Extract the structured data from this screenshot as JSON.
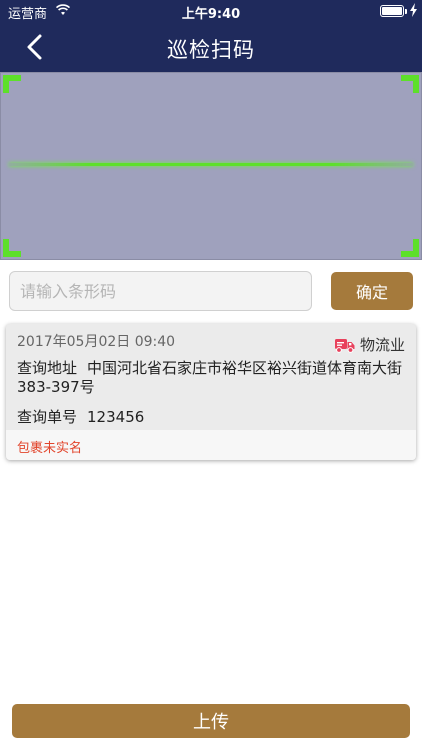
{
  "status_bar": {
    "carrier": "运营商",
    "time": "上午9:40",
    "icons": [
      "wifi-icon",
      "battery-icon",
      "charging-bolt-icon"
    ]
  },
  "nav": {
    "title": "巡检扫码",
    "back_icon": "chevron-left-icon"
  },
  "scanner": {
    "frame_color": "#5de02a"
  },
  "barcode": {
    "placeholder": "请输入条形码",
    "value": "",
    "confirm_label": "确定"
  },
  "record": {
    "datetime": "2017年05月02日 09:40",
    "category_icon": "truck-icon",
    "category": "物流业",
    "address_label": "查询地址",
    "address": "中国河北省石家庄市裕华区裕兴街道体育南大街383-397号",
    "order_label": "查询单号",
    "order_no": "123456",
    "warning": "包裹未实名"
  },
  "upload_label": "上传",
  "colors": {
    "nav_bg": "#1f2a5c",
    "accent": "#a57a3c",
    "warning": "#e2452c",
    "scanner_bg": "#9fa1bd"
  }
}
